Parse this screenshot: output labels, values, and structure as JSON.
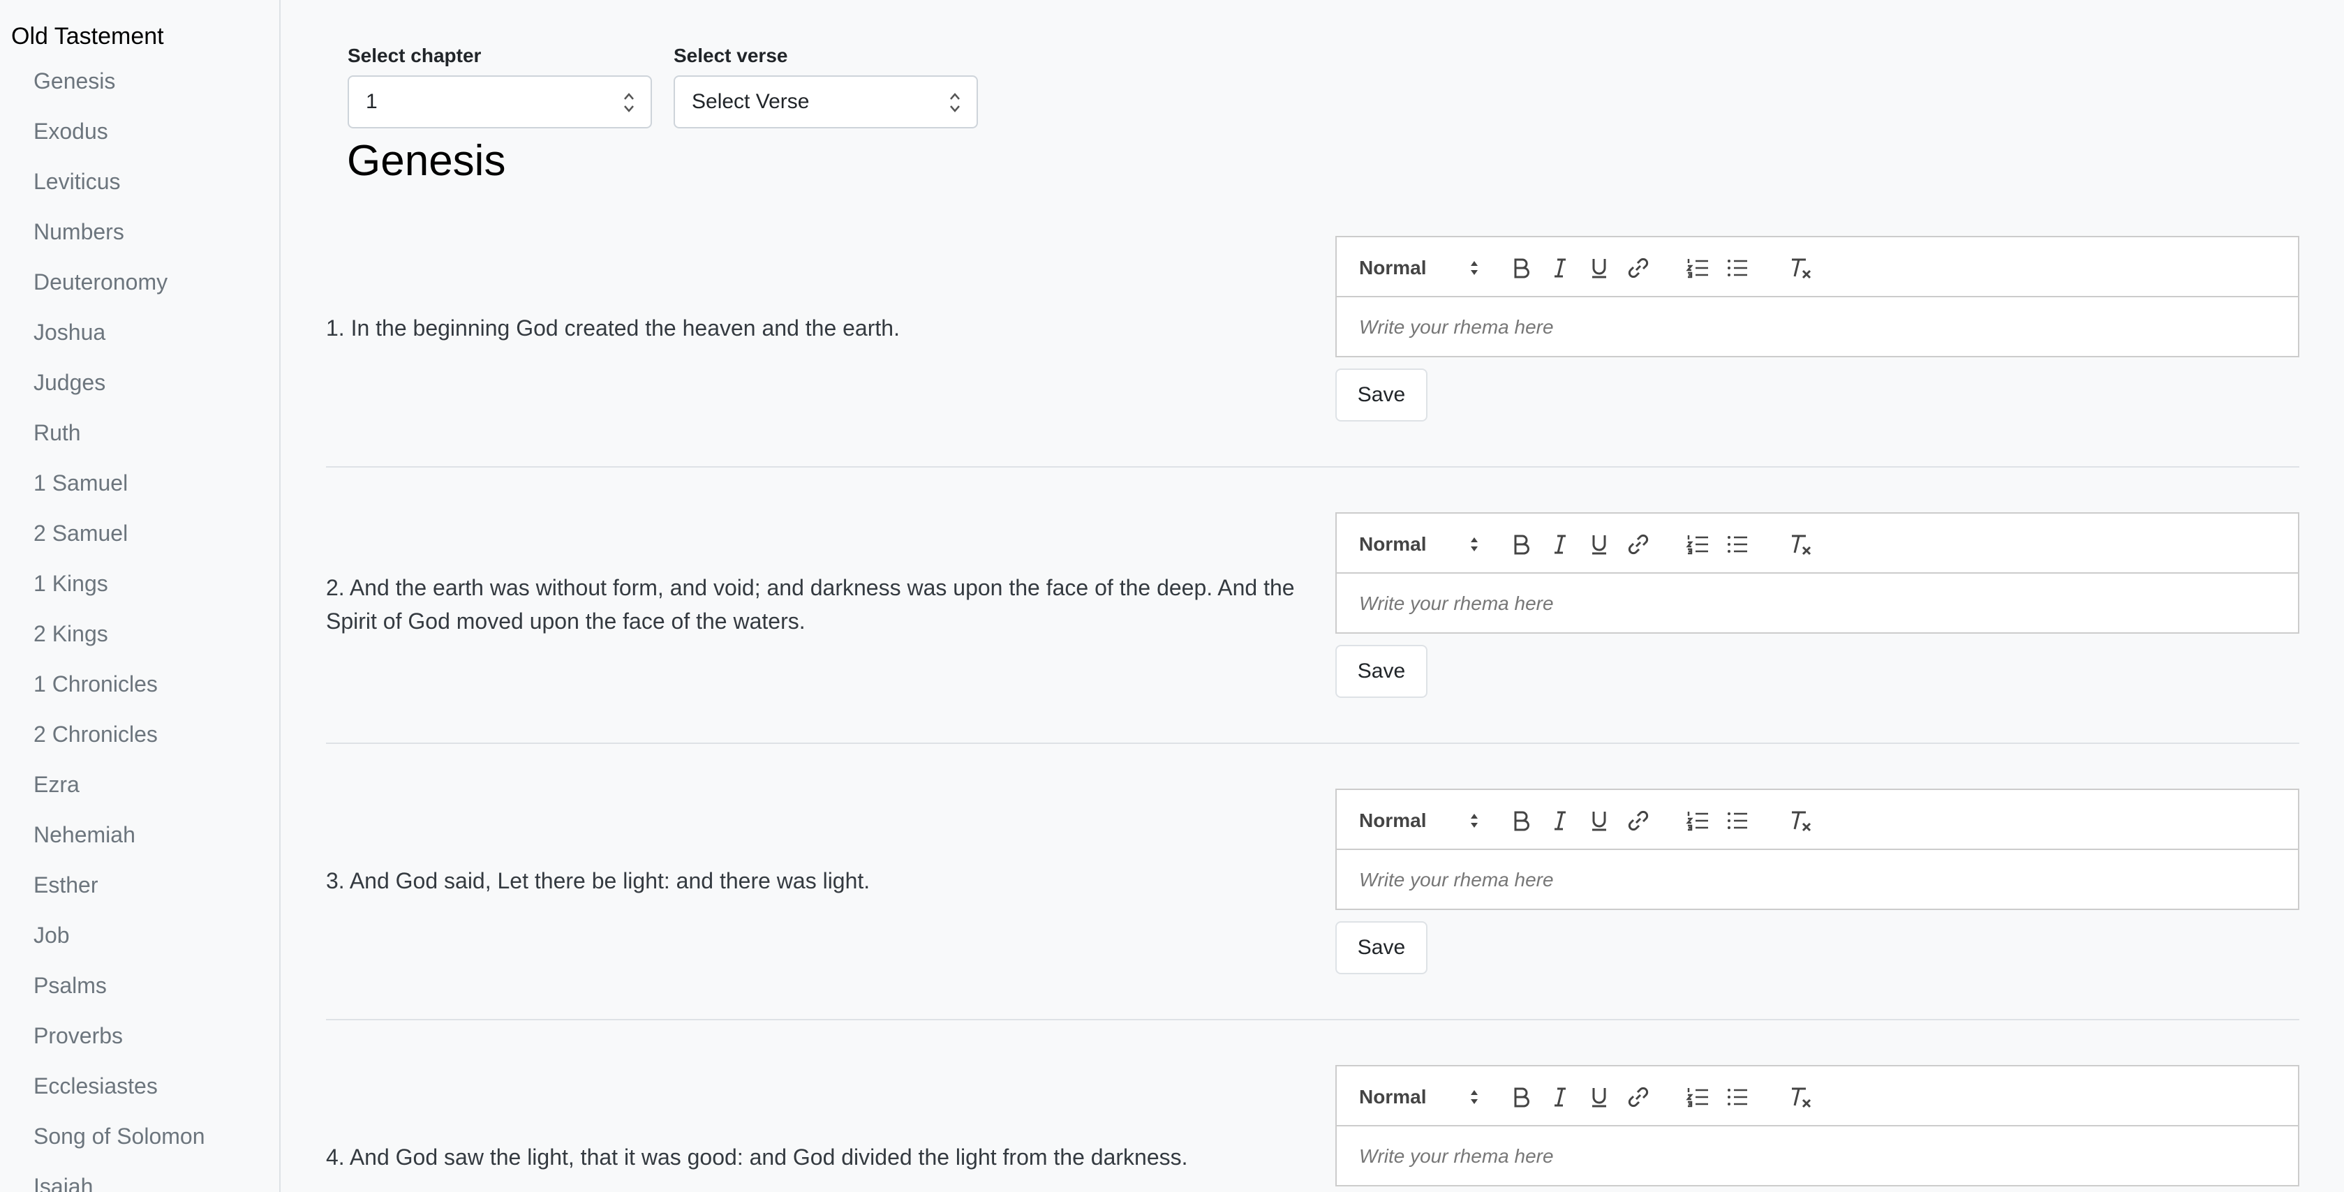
{
  "sidebar": {
    "heading": "Old Tastement",
    "books": [
      "Genesis",
      "Exodus",
      "Leviticus",
      "Numbers",
      "Deuteronomy",
      "Joshua",
      "Judges",
      "Ruth",
      "1 Samuel",
      "2 Samuel",
      "1 Kings",
      "2 Kings",
      "1 Chronicles",
      "2 Chronicles",
      "Ezra",
      "Nehemiah",
      "Esther",
      "Job",
      "Psalms",
      "Proverbs",
      "Ecclesiastes",
      "Song of Solomon",
      "Isaiah"
    ]
  },
  "controls": {
    "chapter_label": "Select chapter",
    "chapter_value": "1",
    "verse_label": "Select verse",
    "verse_value": "Select Verse"
  },
  "page_title": "Genesis",
  "editor": {
    "format_value": "Normal",
    "placeholder": "Write your rhema here",
    "save_label": "Save"
  },
  "verses": [
    {
      "text": "1. In the beginning God created the heaven and the earth."
    },
    {
      "text": "2. And the earth was without form, and void; and darkness was upon the face of the deep. And the Spirit of God moved upon the face of the waters."
    },
    {
      "text": "3. And God said, Let there be light: and there was light."
    },
    {
      "text": "4. And God saw the light, that it was good: and God divided the light from the darkness."
    }
  ]
}
